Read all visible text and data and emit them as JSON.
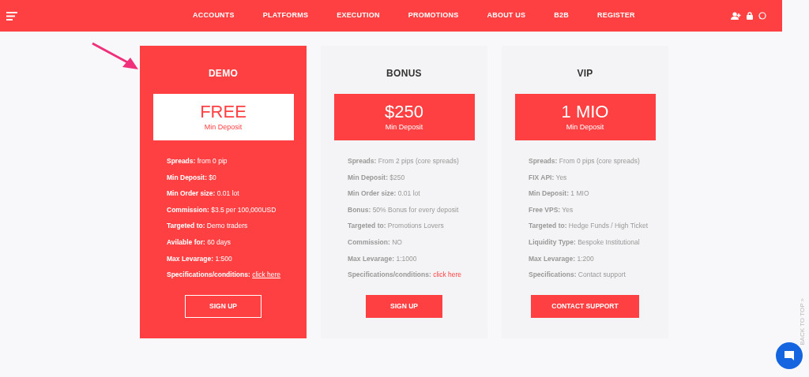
{
  "nav": {
    "items": [
      "ACCOUNTS",
      "PLATFORMS",
      "EXECUTION",
      "PROMOTIONS",
      "ABOUT US",
      "B2B",
      "REGISTER"
    ]
  },
  "plans": [
    {
      "name": "DEMO",
      "highlighted": true,
      "price": "FREE",
      "price_caption": "Min Deposit",
      "features": [
        {
          "label": "Spreads:",
          "value": "from 0 pip"
        },
        {
          "label": "Min Deposit:",
          "value": "$0"
        },
        {
          "label": "Min Order size:",
          "value": "0.01 lot"
        },
        {
          "label": "Commission:",
          "value": "$3.5 per 100,000USD"
        },
        {
          "label": "Targeted to:",
          "value": "Demo traders"
        },
        {
          "label": "Avilable for:",
          "value": "60 days"
        },
        {
          "label": "Max Levarage:",
          "value": "1:500"
        },
        {
          "label": "Specifications/conditions:",
          "link": "click here"
        }
      ],
      "button": "SIGN UP"
    },
    {
      "name": "BONUS",
      "highlighted": false,
      "price": "$250",
      "price_caption": "Min Deposit",
      "features": [
        {
          "label": "Spreads:",
          "value": "From 2 pips (core spreads)"
        },
        {
          "label": "Min Deposit:",
          "value": "$250"
        },
        {
          "label": "Min Order size:",
          "value": "0.01 lot"
        },
        {
          "label": "Bonus:",
          "value": "50% Bonus for every deposit"
        },
        {
          "label": "Targeted to:",
          "value": "Promotions Lovers"
        },
        {
          "label": "Commission:",
          "value": "NO"
        },
        {
          "label": "Max Levarage:",
          "value": "1:1000"
        },
        {
          "label": "Specifications/conditions:",
          "link": "click here"
        }
      ],
      "button": "SIGN UP"
    },
    {
      "name": "VIP",
      "highlighted": false,
      "price": "1 MIO",
      "price_caption": "Min Deposit",
      "features": [
        {
          "label": "Spreads:",
          "value": "From 0 pips (core spreads)"
        },
        {
          "label": "FIX API:",
          "value": "Yes"
        },
        {
          "label": "Min Deposit:",
          "value": "1 MIO"
        },
        {
          "label": "Free VPS:",
          "value": "Yes"
        },
        {
          "label": "Targeted to:",
          "value": "Hedge Funds / High Ticket"
        },
        {
          "label": "Liquidity Type:",
          "value": "Bespoke Institutional"
        },
        {
          "label": "Max Levarage:",
          "value": "1:200"
        },
        {
          "label": "Specifications:",
          "value": "Contact support"
        }
      ],
      "button": "CONTACT SUPPORT"
    }
  ],
  "back_to_top": "BACK TO TOP »"
}
